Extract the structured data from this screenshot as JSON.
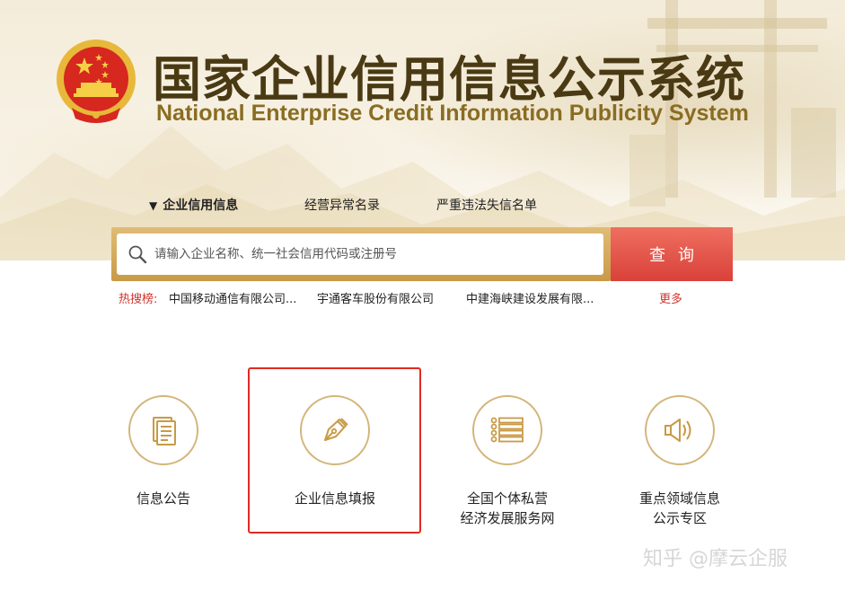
{
  "header": {
    "title_cn": "国家企业信用信息公示系统",
    "title_en": "National Enterprise Credit Information Publicity System"
  },
  "tabs": [
    {
      "label": "企业信用信息",
      "active": true
    },
    {
      "label": "经营异常名录",
      "active": false
    },
    {
      "label": "严重违法失信名单",
      "active": false
    }
  ],
  "search": {
    "placeholder": "请输入企业名称、统一社会信用代码或注册号",
    "button_label": "查询"
  },
  "hot": {
    "label": "热搜榜:",
    "items": [
      "中国移动通信有限公司...",
      "宇通客车股份有限公司",
      "中建海峡建设发展有限..."
    ],
    "more": "更多"
  },
  "features": [
    {
      "label": "信息公告",
      "icon": "document-icon"
    },
    {
      "label": "企业信息填报",
      "icon": "pen-nib-icon"
    },
    {
      "label_line1": "全国个体私营",
      "label_line2": "经济发展服务网",
      "icon": "list-icon"
    },
    {
      "label_line1": "重点领域信息",
      "label_line2": "公示专区",
      "icon": "speaker-icon"
    }
  ],
  "watermark": "知乎 @摩云企服",
  "colors": {
    "gold": "#c99a46",
    "red_button": "#d9413a",
    "highlight": "#e02a22",
    "title_brown": "#4a3a14"
  }
}
